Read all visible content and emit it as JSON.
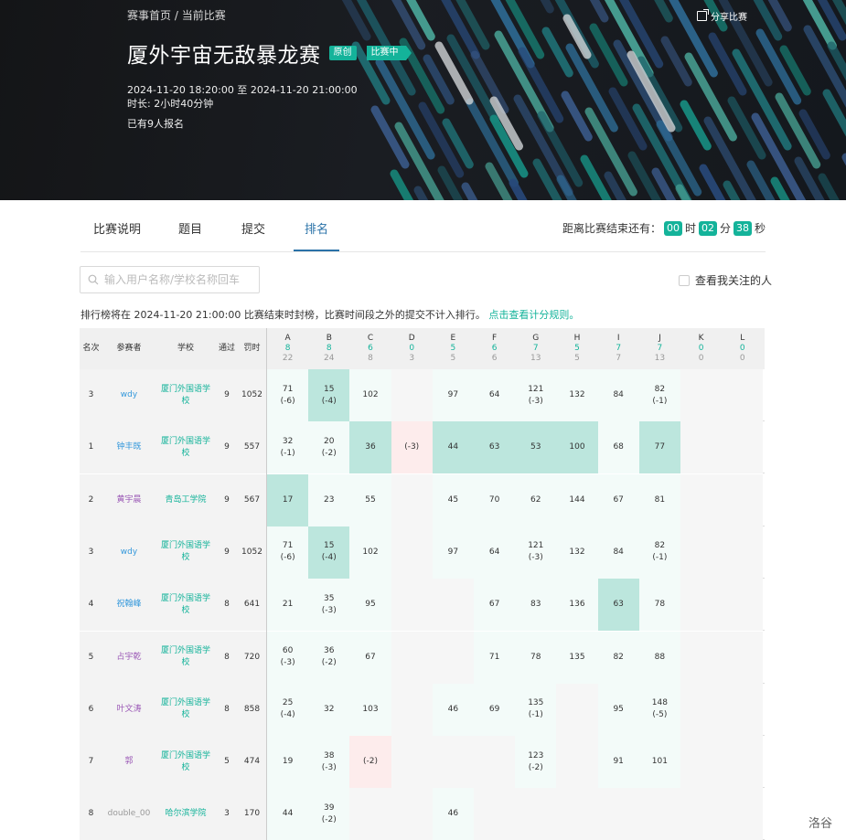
{
  "banner": {
    "breadcrumb_home": "赛事首页",
    "breadcrumb_sep": " / ",
    "breadcrumb_current": "当前比赛",
    "share_label": "分享比赛",
    "title": "厦外宇宙无敌暴龙赛",
    "tag_original": "原创",
    "tag_status": "比赛中",
    "time_range": "2024-11-20 18:20:00 至 2024-11-20 21:00:00",
    "duration": "时长: 2小时40分钟",
    "registered": "已有9人报名"
  },
  "tabs": [
    {
      "label": "比赛说明"
    },
    {
      "label": "题目"
    },
    {
      "label": "提交"
    },
    {
      "label": "排名"
    }
  ],
  "countdown": {
    "label": "距离比赛结束还有：",
    "hours": "00",
    "h_unit": "时",
    "minutes": "02",
    "m_unit": "分",
    "seconds": "38",
    "s_unit": "秒"
  },
  "search": {
    "placeholder": "输入用户名称/学校名称回车"
  },
  "follow_label": "查看我关注的人",
  "notice": {
    "text": "排行榜将在 2024-11-20 21:00:00 比赛结束时封榜，比赛时间段之外的提交不计入排行。",
    "link": "点击查看计分规则。"
  },
  "colors": {
    "accent": "#14b39a",
    "tab_active": "#2a72a8",
    "first_solve": "#bce6dd",
    "fail": "#fdecec"
  },
  "table": {
    "headers": {
      "rank": "名次",
      "user": "参赛者",
      "school": "学校",
      "solved": "通过",
      "penalty": "罚时"
    },
    "problems": [
      {
        "id": "A",
        "ac": "8",
        "total": "22"
      },
      {
        "id": "B",
        "ac": "8",
        "total": "24"
      },
      {
        "id": "C",
        "ac": "6",
        "total": "8"
      },
      {
        "id": "D",
        "ac": "0",
        "total": "3"
      },
      {
        "id": "E",
        "ac": "5",
        "total": "5"
      },
      {
        "id": "F",
        "ac": "6",
        "total": "6"
      },
      {
        "id": "G",
        "ac": "7",
        "total": "13"
      },
      {
        "id": "H",
        "ac": "5",
        "total": "5"
      },
      {
        "id": "I",
        "ac": "7",
        "total": "7"
      },
      {
        "id": "J",
        "ac": "7",
        "total": "13"
      },
      {
        "id": "K",
        "ac": "0",
        "total": "0"
      },
      {
        "id": "L",
        "ac": "0",
        "total": "0"
      }
    ],
    "rows": [
      {
        "rank": "3",
        "user": "wdy",
        "color": "blue",
        "school": "厦门外国语学校",
        "solved": "9",
        "penalty": "1052",
        "cells": [
          [
            "71",
            "(-6)",
            "s"
          ],
          [
            "15",
            "(-4)",
            "f"
          ],
          [
            "102",
            "",
            "s"
          ],
          [
            "",
            "",
            "e"
          ],
          [
            "97",
            "",
            "s"
          ],
          [
            "64",
            "",
            "s"
          ],
          [
            "121",
            "(-3)",
            "s"
          ],
          [
            "132",
            "",
            "s"
          ],
          [
            "84",
            "",
            "s"
          ],
          [
            "82",
            "(-1)",
            "s"
          ],
          [
            "",
            "",
            "e"
          ],
          [
            "",
            "",
            "e"
          ]
        ]
      },
      {
        "rank": "1",
        "user": "钟丰既",
        "color": "blue",
        "school": "厦门外国语学校",
        "solved": "9",
        "penalty": "557",
        "cells": [
          [
            "32",
            "(-1)",
            "s"
          ],
          [
            "20",
            "(-2)",
            "s"
          ],
          [
            "36",
            "",
            "f"
          ],
          [
            "(-3)",
            "",
            "x"
          ],
          [
            "44",
            "",
            "f"
          ],
          [
            "63",
            "",
            "f"
          ],
          [
            "53",
            "",
            "f"
          ],
          [
            "100",
            "",
            "f"
          ],
          [
            "68",
            "",
            "s"
          ],
          [
            "77",
            "",
            "f"
          ],
          [
            "",
            "",
            "e"
          ],
          [
            "",
            "",
            "e"
          ]
        ]
      },
      {
        "rank": "2",
        "user": "黄宇晨",
        "color": "purple",
        "school": "青岛工学院",
        "solved": "9",
        "penalty": "567",
        "cells": [
          [
            "17",
            "",
            "f"
          ],
          [
            "23",
            "",
            "s"
          ],
          [
            "55",
            "",
            "s"
          ],
          [
            "",
            "",
            "e"
          ],
          [
            "45",
            "",
            "s"
          ],
          [
            "70",
            "",
            "s"
          ],
          [
            "62",
            "",
            "s"
          ],
          [
            "144",
            "",
            "s"
          ],
          [
            "67",
            "",
            "s"
          ],
          [
            "81",
            "",
            "s"
          ],
          [
            "",
            "",
            "e"
          ],
          [
            "",
            "",
            "e"
          ]
        ]
      },
      {
        "rank": "3",
        "user": "wdy",
        "color": "blue",
        "school": "厦门外国语学校",
        "solved": "9",
        "penalty": "1052",
        "cells": [
          [
            "71",
            "(-6)",
            "s"
          ],
          [
            "15",
            "(-4)",
            "f"
          ],
          [
            "102",
            "",
            "s"
          ],
          [
            "",
            "",
            "e"
          ],
          [
            "97",
            "",
            "s"
          ],
          [
            "64",
            "",
            "s"
          ],
          [
            "121",
            "(-3)",
            "s"
          ],
          [
            "132",
            "",
            "s"
          ],
          [
            "84",
            "",
            "s"
          ],
          [
            "82",
            "(-1)",
            "s"
          ],
          [
            "",
            "",
            "e"
          ],
          [
            "",
            "",
            "e"
          ]
        ]
      },
      {
        "rank": "4",
        "user": "祝翰峰",
        "color": "blue",
        "school": "厦门外国语学校",
        "solved": "8",
        "penalty": "641",
        "cells": [
          [
            "21",
            "",
            "s"
          ],
          [
            "35",
            "(-3)",
            "s"
          ],
          [
            "95",
            "",
            "s"
          ],
          [
            "",
            "",
            "e"
          ],
          [
            "",
            "",
            "e"
          ],
          [
            "67",
            "",
            "s"
          ],
          [
            "83",
            "",
            "s"
          ],
          [
            "136",
            "",
            "s"
          ],
          [
            "63",
            "",
            "f"
          ],
          [
            "78",
            "",
            "s"
          ],
          [
            "",
            "",
            "e"
          ],
          [
            "",
            "",
            "e"
          ]
        ]
      },
      {
        "rank": "5",
        "user": "占宇乾",
        "color": "purple",
        "school": "厦门外国语学校",
        "solved": "8",
        "penalty": "720",
        "cells": [
          [
            "60",
            "(-3)",
            "s"
          ],
          [
            "36",
            "(-2)",
            "s"
          ],
          [
            "67",
            "",
            "s"
          ],
          [
            "",
            "",
            "e"
          ],
          [
            "",
            "",
            "e"
          ],
          [
            "71",
            "",
            "s"
          ],
          [
            "78",
            "",
            "s"
          ],
          [
            "135",
            "",
            "s"
          ],
          [
            "82",
            "",
            "s"
          ],
          [
            "88",
            "",
            "s"
          ],
          [
            "",
            "",
            "e"
          ],
          [
            "",
            "",
            "e"
          ]
        ]
      },
      {
        "rank": "6",
        "user": "叶文涛",
        "color": "purple",
        "school": "厦门外国语学校",
        "solved": "8",
        "penalty": "858",
        "cells": [
          [
            "25",
            "(-4)",
            "s"
          ],
          [
            "32",
            "",
            "s"
          ],
          [
            "103",
            "",
            "s"
          ],
          [
            "",
            "",
            "e"
          ],
          [
            "46",
            "",
            "s"
          ],
          [
            "69",
            "",
            "s"
          ],
          [
            "135",
            "(-1)",
            "s"
          ],
          [
            "",
            "",
            "e"
          ],
          [
            "95",
            "",
            "s"
          ],
          [
            "148",
            "(-5)",
            "s"
          ],
          [
            "",
            "",
            "e"
          ],
          [
            "",
            "",
            "e"
          ]
        ]
      },
      {
        "rank": "7",
        "user": "郭",
        "color": "purple",
        "school": "厦门外国语学校",
        "solved": "5",
        "penalty": "474",
        "cells": [
          [
            "19",
            "",
            "s"
          ],
          [
            "38",
            "(-3)",
            "s"
          ],
          [
            "(-2)",
            "",
            "x"
          ],
          [
            "",
            "",
            "e"
          ],
          [
            "",
            "",
            "e"
          ],
          [
            "",
            "",
            "e"
          ],
          [
            "123",
            "(-2)",
            "s"
          ],
          [
            "",
            "",
            "e"
          ],
          [
            "91",
            "",
            "s"
          ],
          [
            "101",
            "",
            "s"
          ],
          [
            "",
            "",
            "e"
          ],
          [
            "",
            "",
            "e"
          ]
        ]
      },
      {
        "rank": "8",
        "user": "double_00",
        "color": "gray",
        "school": "哈尔滨学院",
        "solved": "3",
        "penalty": "170",
        "cells": [
          [
            "44",
            "",
            "s"
          ],
          [
            "39",
            "(-2)",
            "s"
          ],
          [
            "",
            "",
            "e"
          ],
          [
            "",
            "",
            "e"
          ],
          [
            "46",
            "",
            "s"
          ],
          [
            "",
            "",
            "e"
          ],
          [
            "",
            "",
            "e"
          ],
          [
            "",
            "",
            "e"
          ],
          [
            "",
            "",
            "e"
          ],
          [
            "",
            "",
            "e"
          ],
          [
            "",
            "",
            "e"
          ],
          [
            "",
            "",
            "e"
          ]
        ]
      }
    ]
  },
  "watermark": "洛谷"
}
